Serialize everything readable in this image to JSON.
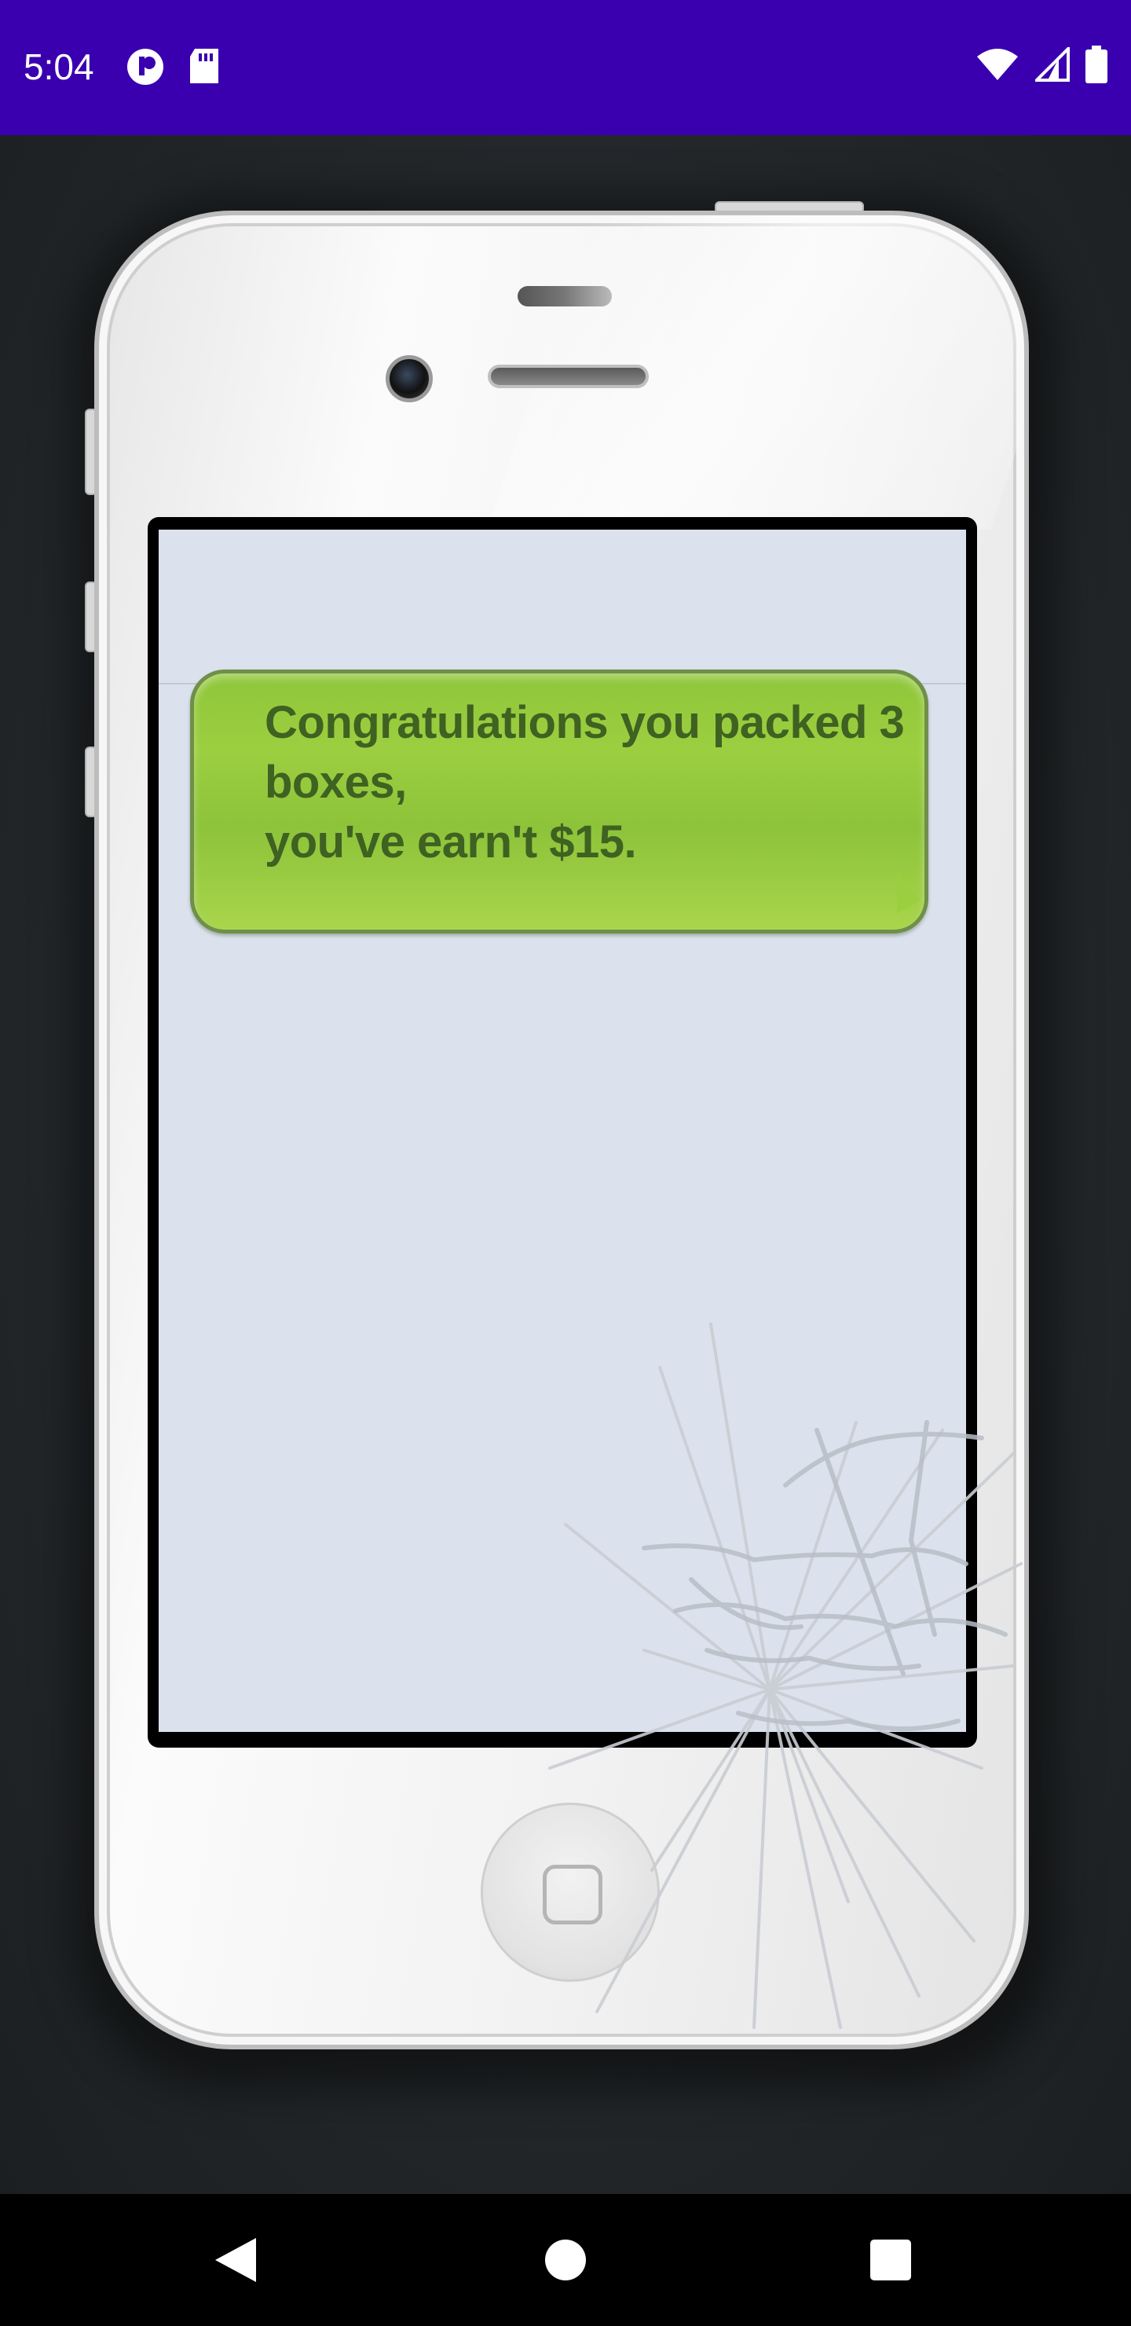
{
  "status_bar": {
    "time": "5:04",
    "left_icons": [
      "notification-badge-icon",
      "sd-card-icon"
    ],
    "right_icons": [
      "wifi-icon",
      "cell-signal-icon",
      "battery-icon"
    ],
    "color": "#3a00b0"
  },
  "phone": {
    "message": {
      "text": "Congratulations you packed 3\nboxes,\nyou've earn't $15.",
      "bubble_color": "#9ccf40",
      "text_color": "#3f6121"
    },
    "screen_color": "#dbe2ee",
    "cracked": true
  },
  "nav_bar": {
    "buttons": [
      "back-icon",
      "home-icon",
      "recents-icon"
    ]
  }
}
